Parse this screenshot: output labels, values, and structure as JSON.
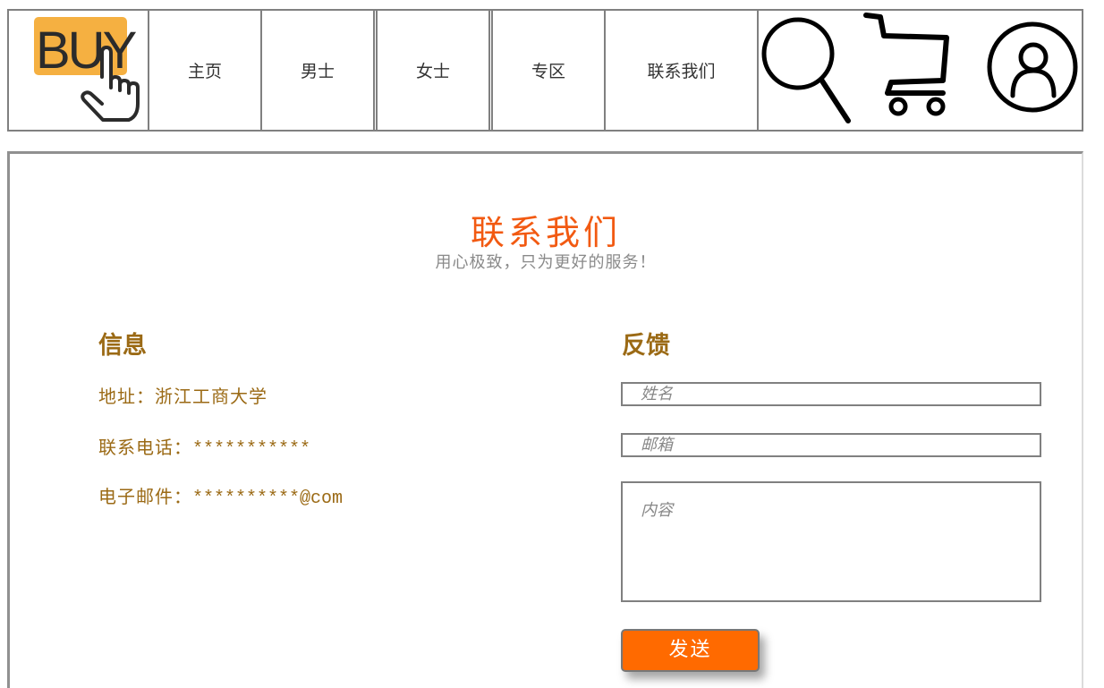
{
  "brand": {
    "logo_text": "BUY",
    "logo_color": "#f5b041"
  },
  "nav": {
    "items": [
      {
        "label": "主页"
      },
      {
        "label": "男士"
      },
      {
        "label": "女士"
      },
      {
        "label": "专区"
      },
      {
        "label": "联系我们"
      }
    ],
    "icons": [
      "search-icon",
      "cart-icon",
      "user-icon"
    ]
  },
  "contact": {
    "title": "联系我们",
    "subtitle": "用心极致，只为更好的服务！",
    "info": {
      "heading": "信息",
      "address_label": "地址：",
      "address_value": "浙江工商大学",
      "phone_label": "联系电话：",
      "phone_value": "***********",
      "email_label": "电子邮件：",
      "email_value": "**********@com"
    },
    "feedback": {
      "heading": "反馈",
      "name_placeholder": "姓名",
      "email_placeholder": "邮箱",
      "content_placeholder": "内容",
      "send_label": "发送"
    }
  },
  "colors": {
    "accent": "#f25a12",
    "heading": "#9b6a15",
    "button": "#ff6a00",
    "border": "#808080"
  }
}
